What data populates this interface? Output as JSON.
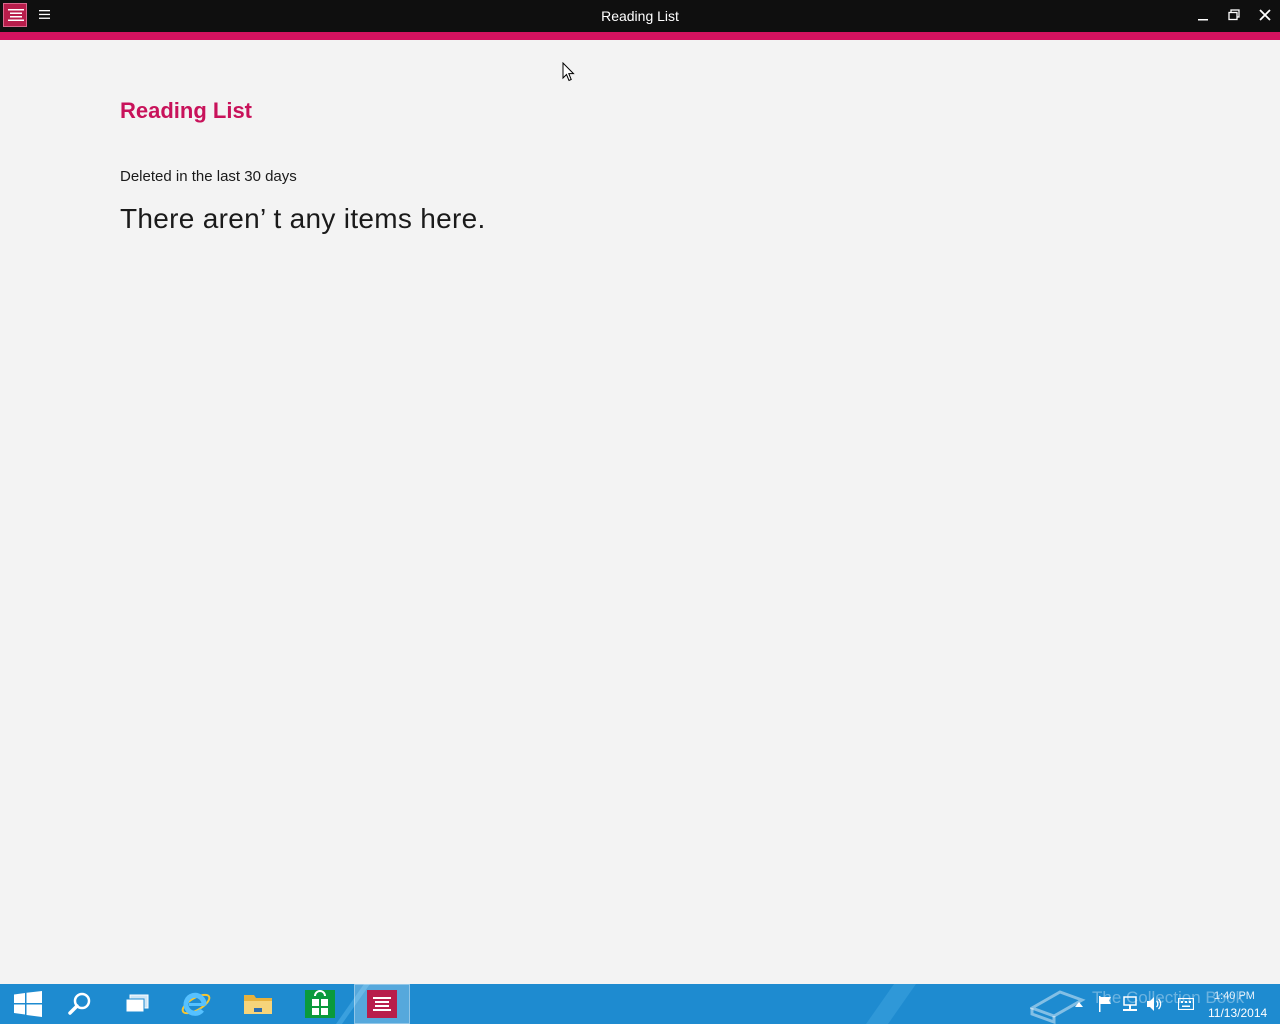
{
  "window": {
    "title": "Reading List",
    "accent_color": "#d4125f",
    "titlebar_color": "#0f0f0f"
  },
  "titlebar": {
    "app_icon": "reading-list-icon",
    "menu_icon": "hamburger-menu-icon",
    "buttons": [
      "minimize-icon",
      "restore-icon",
      "close-icon"
    ]
  },
  "page": {
    "title": "Reading List",
    "title_color": "#c8125a",
    "section_label": "Deleted in the last 30 days",
    "empty_message": "There aren’ t any items here."
  },
  "taskbar": {
    "color": "#1e8bd0",
    "pinned": [
      {
        "icon": "windows-start-icon"
      },
      {
        "icon": "search-icon"
      },
      {
        "icon": "task-view-icon"
      },
      {
        "icon": "internet-explorer-icon"
      },
      {
        "icon": "file-explorer-icon"
      },
      {
        "icon": "store-icon"
      },
      {
        "icon": "reading-list-icon",
        "active": true
      }
    ],
    "tray": {
      "watermark": "The Collection Book",
      "icons": [
        "show-hidden-icons-icon",
        "action-center-flag-icon",
        "network-icon",
        "volume-icon",
        "keyboard-icon"
      ],
      "time": "1:40 PM",
      "date": "11/13/2014"
    }
  }
}
